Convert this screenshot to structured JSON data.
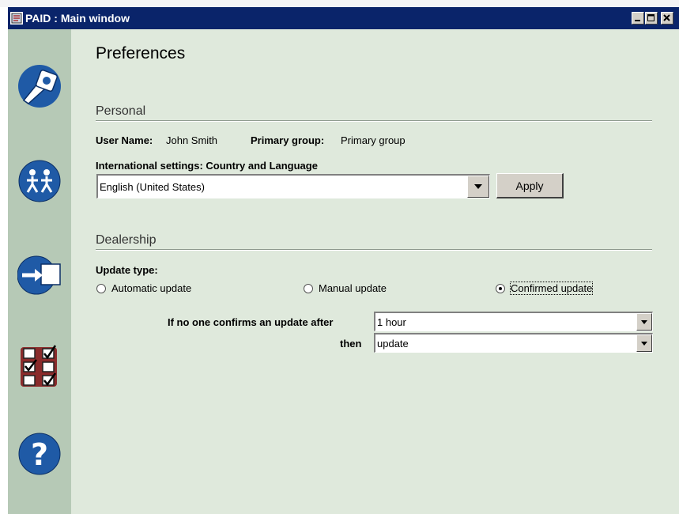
{
  "window": {
    "title": "PAID : Main window"
  },
  "sidebar": {
    "icons": [
      {
        "name": "tools-icon"
      },
      {
        "name": "users-icon"
      },
      {
        "name": "login-icon"
      },
      {
        "name": "checklist-icon"
      },
      {
        "name": "help-icon"
      }
    ]
  },
  "page": {
    "title": "Preferences"
  },
  "personal": {
    "section_title": "Personal",
    "user_name_label": "User Name:",
    "user_name_value": "John Smith",
    "primary_group_label": "Primary group:",
    "primary_group_value": "Primary group",
    "intl_label": "International settings: Country and Language",
    "language_value": "English (United States)",
    "apply_label": "Apply"
  },
  "dealership": {
    "section_title": "Dealership",
    "update_type_label": "Update type:",
    "options": [
      {
        "label": "Automatic update",
        "selected": false
      },
      {
        "label": "Manual update",
        "selected": false
      },
      {
        "label": "Confirmed update",
        "selected": true
      }
    ],
    "confirm_after_label": "If no one confirms an update after",
    "confirm_after_value": "1 hour",
    "then_label": "then",
    "then_value": "update"
  },
  "colors": {
    "titlebar": "#0a246a",
    "sidebar": "#b6c9b6",
    "content": "#dfe9dc",
    "icon_blue": "#1f5aa6"
  }
}
